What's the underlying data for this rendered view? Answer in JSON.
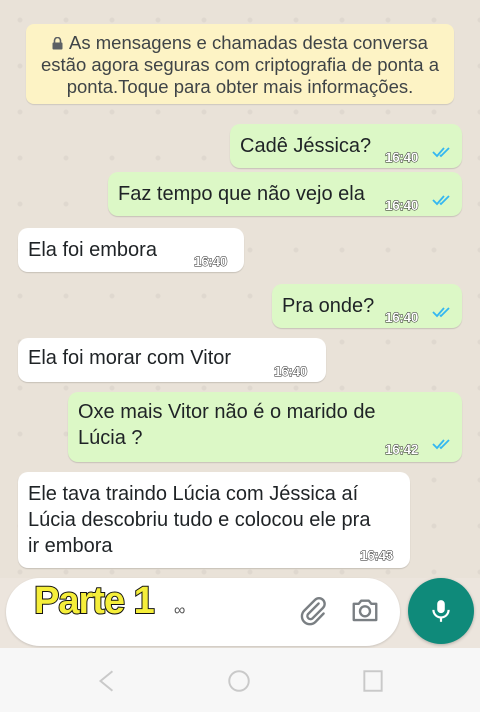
{
  "system_message": "As mensagens e chamadas desta conversa estão agora seguras com criptografia de ponta a ponta.Toque para obter mais informações.",
  "messages": [
    {
      "direction": "out",
      "text": "Cadê Jéssica?",
      "time": "16:40",
      "status": "read"
    },
    {
      "direction": "out",
      "text": "Faz tempo que não vejo ela",
      "time": "16:40",
      "status": "read"
    },
    {
      "direction": "in",
      "text": "Ela foi embora",
      "time": "16:40"
    },
    {
      "direction": "out",
      "text": "Pra onde?",
      "time": "16:40",
      "status": "read"
    },
    {
      "direction": "in",
      "text": "Ela foi morar com Vitor",
      "time": "16:40"
    },
    {
      "direction": "out",
      "text": "Oxe mais Vitor não é o marido de Lúcia ?",
      "lines": [
        "Oxe mais Vitor não é o marido de",
        "Lúcia ?"
      ],
      "time": "16:42",
      "status": "read"
    },
    {
      "direction": "in",
      "text": "Ele tava traindo Lúcia com Jéssica aí Lúcia descobriu tudo e colocou ele pra ir embora",
      "lines": [
        "Ele tava traindo Lúcia com Jéssica aí",
        "Lúcia descobriu tudo e colocou ele pra",
        "ir embora"
      ],
      "time": "16:43"
    }
  ],
  "composer": {
    "overlay_text": "Parte 1",
    "typed_text": "∞"
  },
  "icons": {
    "lock": "lock-icon",
    "attach": "paperclip-icon",
    "camera": "camera-icon",
    "mic": "microphone-icon",
    "ticks": "double-check-icon",
    "nav": [
      "back-icon",
      "home-icon",
      "recents-icon"
    ]
  },
  "colors": {
    "outgoing_bubble": "#dcf8c6",
    "incoming_bubble": "#ffffff",
    "system_bubble": "#fdf3c5",
    "read_ticks": "#34b7f1",
    "mic_button": "#0f8a7a",
    "overlay_text": "#f5ee3a"
  }
}
